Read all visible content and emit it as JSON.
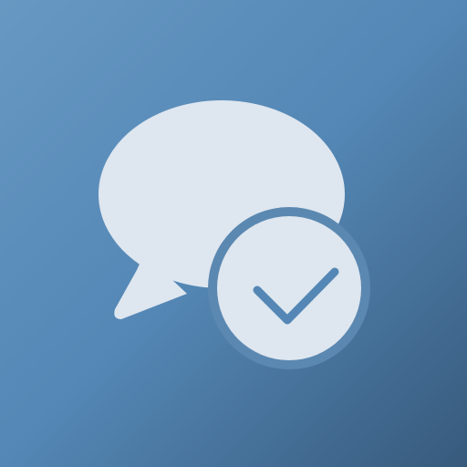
{
  "icon": {
    "name": "chat-bubble-checkmark-icon",
    "colors": {
      "background_start": "#6798c3",
      "background_mid": "#5487b5",
      "background_end": "#375a7c",
      "foreground": "#dee6ef"
    }
  }
}
